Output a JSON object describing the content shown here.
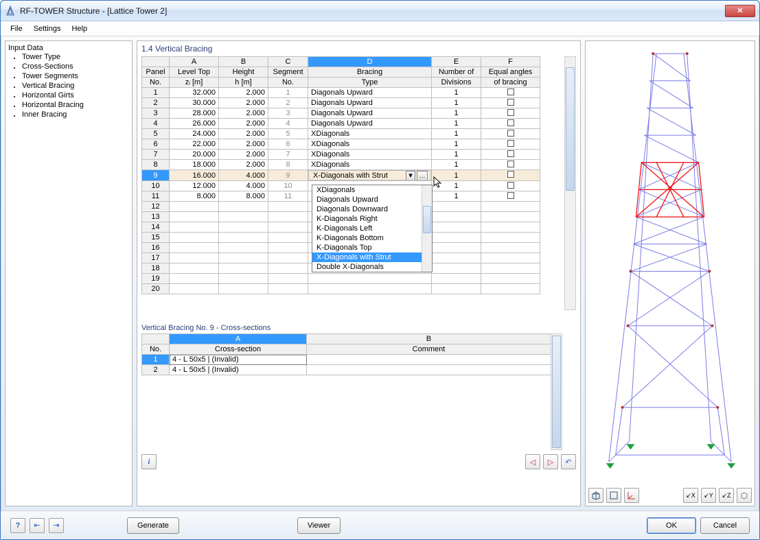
{
  "window": {
    "title": "RF-TOWER Structure - [Lattice Tower 2]"
  },
  "menu": {
    "file": "File",
    "settings": "Settings",
    "help": "Help"
  },
  "sidebar": {
    "heading": "Input Data",
    "items": [
      "Tower Type",
      "Cross-Sections",
      "Tower Segments",
      "Vertical Bracing",
      "Horizontal Girts",
      "Horizontal Bracing",
      "Inner Bracing"
    ]
  },
  "panel": {
    "title": "1.4 Vertical Bracing",
    "cols": {
      "panelno": {
        "l1": "Panel",
        "l2": "No."
      },
      "A": {
        "l1": "Level Top",
        "l2": "zᵢ [m]"
      },
      "B": {
        "l1": "Height",
        "l2": "h [m]"
      },
      "C": {
        "l1": "Segment",
        "l2": "No."
      },
      "D": {
        "l1": "Bracing",
        "l2": "Type"
      },
      "E": {
        "l1": "Number of",
        "l2": "Divisions"
      },
      "F": {
        "l1": "Equal angles",
        "l2": "of bracing"
      }
    },
    "rows": [
      {
        "no": "1",
        "A": "32.000",
        "B": "2.000",
        "C": "1",
        "D": "Diagonals Upward",
        "E": "1",
        "F": false
      },
      {
        "no": "2",
        "A": "30.000",
        "B": "2.000",
        "C": "2",
        "D": "Diagonals Upward",
        "E": "1",
        "F": false
      },
      {
        "no": "3",
        "A": "28.000",
        "B": "2.000",
        "C": "3",
        "D": "Diagonals Upward",
        "E": "1",
        "F": false
      },
      {
        "no": "4",
        "A": "26.000",
        "B": "2.000",
        "C": "4",
        "D": "Diagonals Upward",
        "E": "1",
        "F": false
      },
      {
        "no": "5",
        "A": "24.000",
        "B": "2.000",
        "C": "5",
        "D": "XDiagonals",
        "E": "1",
        "F": false
      },
      {
        "no": "6",
        "A": "22.000",
        "B": "2.000",
        "C": "6",
        "D": "XDiagonals",
        "E": "1",
        "F": false
      },
      {
        "no": "7",
        "A": "20.000",
        "B": "2.000",
        "C": "7",
        "D": "XDiagonals",
        "E": "1",
        "F": false
      },
      {
        "no": "8",
        "A": "18.000",
        "B": "2.000",
        "C": "8",
        "D": "XDiagonals",
        "E": "1",
        "F": false
      },
      {
        "no": "9",
        "A": "16.000",
        "B": "4.000",
        "C": "9",
        "D": "X-Diagonals with Strut",
        "E": "1",
        "F": false,
        "selected": true
      },
      {
        "no": "10",
        "A": "12.000",
        "B": "4.000",
        "C": "10",
        "D": "",
        "E": "1",
        "F": false
      },
      {
        "no": "11",
        "A": "8.000",
        "B": "8.000",
        "C": "11",
        "D": "",
        "E": "1",
        "F": false
      },
      {
        "no": "12"
      },
      {
        "no": "13"
      },
      {
        "no": "14"
      },
      {
        "no": "15"
      },
      {
        "no": "16"
      },
      {
        "no": "17"
      },
      {
        "no": "18"
      },
      {
        "no": "19"
      },
      {
        "no": "20"
      }
    ],
    "dropdown": {
      "items": [
        "XDiagonals",
        "Diagonals Upward",
        "Diagonals Downward",
        "K-Diagonals Right",
        "K-Diagonals Left",
        "K-Diagonals Bottom",
        "K-Diagonals Top",
        "X-Diagonals with Strut",
        "Double X-Diagonals"
      ],
      "selected": 7
    }
  },
  "subpanel": {
    "title": "Vertical Bracing No. 9  -  Cross-sections",
    "cols": {
      "no": "No.",
      "A": "Cross-section",
      "B": "Comment"
    },
    "rows": [
      {
        "no": "1",
        "A": "4 - L 50x5 | (Invalid)",
        "B": "",
        "selected": true
      },
      {
        "no": "2",
        "A": "4 - L 50x5 | (Invalid)",
        "B": ""
      }
    ]
  },
  "footer": {
    "generate": "Generate",
    "viewer": "Viewer",
    "ok": "OK",
    "cancel": "Cancel"
  }
}
